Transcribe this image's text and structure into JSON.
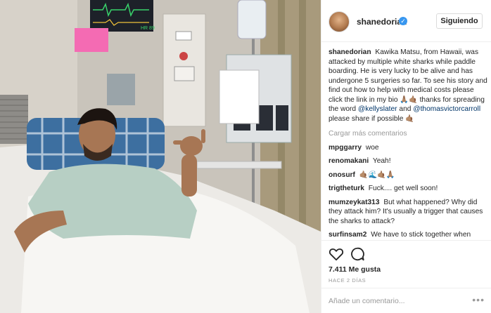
{
  "post": {
    "image_alt": "Hospital bed photo",
    "monitor_readout": "HR 89",
    "pink_note": ""
  },
  "header": {
    "username": "shanedorian",
    "follow_label": "Siguiendo"
  },
  "caption": {
    "username": "shanedorian",
    "text_1": "Kawika Matsu, from Hawaii, was attacked by multiple white sharks while paddle boarding. He is very lucky to be alive and has undergone 5 surgeries so far. To see his story and find out how to help with medical costs please click the link in my bio",
    "emoji_1": "🙏🏽🤙🏽",
    "text_2": "thanks for spreading the word",
    "mention_1": "@kellyslater",
    "text_3": "and",
    "mention_2": "@thomasvictorcarroll",
    "text_4": "please share if possible",
    "emoji_2": "🤙🏽"
  },
  "load_more": "Cargar más comentarios",
  "comments": [
    {
      "user": "mpggarry",
      "text": "woe"
    },
    {
      "user": "renomakani",
      "text": "Yeah!"
    },
    {
      "user": "onosurf",
      "text": "🤙🏽🌊🤙🏽🙏🏽"
    },
    {
      "user": "trigtheturk",
      "text": "Fuck.... get well soon!"
    },
    {
      "user": "mumzeykat313",
      "text": "But what happened? Why did they attack him? It's usually a trigger that causes the sharks to attack?"
    },
    {
      "user": "surfinsam2",
      "text": "We have to stick together when"
    }
  ],
  "actions": {
    "likes": "7.411 Me gusta",
    "time": "HACE 2 DÍAS"
  },
  "add_comment": {
    "placeholder": "Añade un comentario...",
    "more": "•••"
  }
}
